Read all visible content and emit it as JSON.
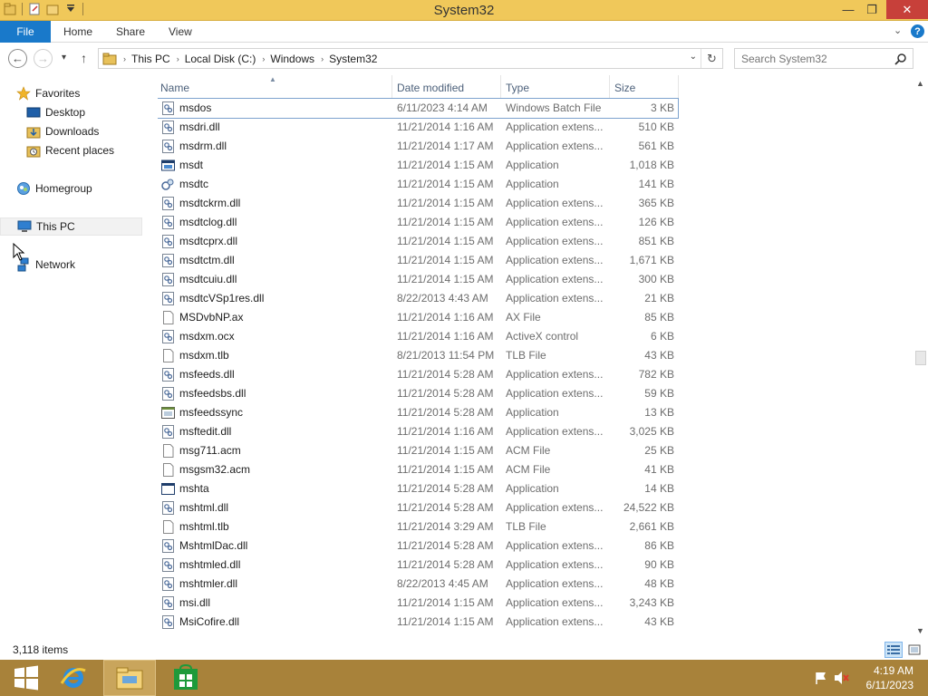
{
  "window": {
    "title": "System32",
    "minimize_glyph": "—",
    "restore_glyph": "❐",
    "close_glyph": "✕"
  },
  "ribbon": {
    "tabs": [
      "File",
      "Home",
      "Share",
      "View"
    ],
    "expand_glyph": "⌄",
    "help_glyph": "?"
  },
  "address": {
    "crumbs": [
      "This PC",
      "Local Disk (C:)",
      "Windows",
      "System32"
    ],
    "separator": "›",
    "dropdown_glyph": "⌄",
    "refresh_glyph": "↻",
    "back_glyph": "←",
    "forward_glyph": "→",
    "recent_glyph": "▾",
    "up_glyph": "↑"
  },
  "search": {
    "placeholder": "Search System32"
  },
  "nav": {
    "favorites": "Favorites",
    "desktop": "Desktop",
    "downloads": "Downloads",
    "recent": "Recent places",
    "homegroup": "Homegroup",
    "thispc": "This PC",
    "network": "Network"
  },
  "columns": {
    "name": "Name",
    "date": "Date modified",
    "type": "Type",
    "size": "Size",
    "sort_glyph": "▲"
  },
  "files": [
    {
      "name": "msdos",
      "date": "6/11/2023 4:14 AM",
      "type": "Windows Batch File",
      "size": "3 KB",
      "icon": "batch-file-icon"
    },
    {
      "name": "msdri.dll",
      "date": "11/21/2014 1:16 AM",
      "type": "Application extens...",
      "size": "510 KB",
      "icon": "dll-icon"
    },
    {
      "name": "msdrm.dll",
      "date": "11/21/2014 1:17 AM",
      "type": "Application extens...",
      "size": "561 KB",
      "icon": "dll-icon"
    },
    {
      "name": "msdt",
      "date": "11/21/2014 1:15 AM",
      "type": "Application",
      "size": "1,018 KB",
      "icon": "app-icon"
    },
    {
      "name": "msdtc",
      "date": "11/21/2014 1:15 AM",
      "type": "Application",
      "size": "141 KB",
      "icon": "dtc-app-icon"
    },
    {
      "name": "msdtckrm.dll",
      "date": "11/21/2014 1:15 AM",
      "type": "Application extens...",
      "size": "365 KB",
      "icon": "dll-icon"
    },
    {
      "name": "msdtclog.dll",
      "date": "11/21/2014 1:15 AM",
      "type": "Application extens...",
      "size": "126 KB",
      "icon": "dll-icon"
    },
    {
      "name": "msdtcprx.dll",
      "date": "11/21/2014 1:15 AM",
      "type": "Application extens...",
      "size": "851 KB",
      "icon": "dll-icon"
    },
    {
      "name": "msdtctm.dll",
      "date": "11/21/2014 1:15 AM",
      "type": "Application extens...",
      "size": "1,671 KB",
      "icon": "dll-icon"
    },
    {
      "name": "msdtcuiu.dll",
      "date": "11/21/2014 1:15 AM",
      "type": "Application extens...",
      "size": "300 KB",
      "icon": "dll-icon"
    },
    {
      "name": "msdtcVSp1res.dll",
      "date": "8/22/2013 4:43 AM",
      "type": "Application extens...",
      "size": "21 KB",
      "icon": "dll-icon"
    },
    {
      "name": "MSDvbNP.ax",
      "date": "11/21/2014 1:16 AM",
      "type": "AX File",
      "size": "85 KB",
      "icon": "blank-file-icon"
    },
    {
      "name": "msdxm.ocx",
      "date": "11/21/2014 1:16 AM",
      "type": "ActiveX control",
      "size": "6 KB",
      "icon": "dll-icon"
    },
    {
      "name": "msdxm.tlb",
      "date": "8/21/2013 11:54 PM",
      "type": "TLB File",
      "size": "43 KB",
      "icon": "blank-file-icon"
    },
    {
      "name": "msfeeds.dll",
      "date": "11/21/2014 5:28 AM",
      "type": "Application extens...",
      "size": "782 KB",
      "icon": "dll-icon"
    },
    {
      "name": "msfeedsbs.dll",
      "date": "11/21/2014 5:28 AM",
      "type": "Application extens...",
      "size": "59 KB",
      "icon": "dll-icon"
    },
    {
      "name": "msfeedssync",
      "date": "11/21/2014 5:28 AM",
      "type": "Application",
      "size": "13 KB",
      "icon": "app-small-icon"
    },
    {
      "name": "msftedit.dll",
      "date": "11/21/2014 1:16 AM",
      "type": "Application extens...",
      "size": "3,025 KB",
      "icon": "dll-icon"
    },
    {
      "name": "msg711.acm",
      "date": "11/21/2014 1:15 AM",
      "type": "ACM File",
      "size": "25 KB",
      "icon": "blank-file-icon"
    },
    {
      "name": "msgsm32.acm",
      "date": "11/21/2014 1:15 AM",
      "type": "ACM File",
      "size": "41 KB",
      "icon": "blank-file-icon"
    },
    {
      "name": "mshta",
      "date": "11/21/2014 5:28 AM",
      "type": "Application",
      "size": "14 KB",
      "icon": "window-app-icon"
    },
    {
      "name": "mshtml.dll",
      "date": "11/21/2014 5:28 AM",
      "type": "Application extens...",
      "size": "24,522 KB",
      "icon": "dll-icon"
    },
    {
      "name": "mshtml.tlb",
      "date": "11/21/2014 3:29 AM",
      "type": "TLB File",
      "size": "2,661 KB",
      "icon": "blank-file-icon"
    },
    {
      "name": "MshtmlDac.dll",
      "date": "11/21/2014 5:28 AM",
      "type": "Application extens...",
      "size": "86 KB",
      "icon": "dll-icon"
    },
    {
      "name": "mshtmled.dll",
      "date": "11/21/2014 5:28 AM",
      "type": "Application extens...",
      "size": "90 KB",
      "icon": "dll-icon"
    },
    {
      "name": "mshtmler.dll",
      "date": "8/22/2013 4:45 AM",
      "type": "Application extens...",
      "size": "48 KB",
      "icon": "dll-icon"
    },
    {
      "name": "msi.dll",
      "date": "11/21/2014 1:15 AM",
      "type": "Application extens...",
      "size": "3,243 KB",
      "icon": "dll-icon"
    },
    {
      "name": "MsiCofire.dll",
      "date": "11/21/2014 1:15 AM",
      "type": "Application extens...",
      "size": "43 KB",
      "icon": "dll-icon"
    }
  ],
  "status": {
    "item_count": "3,118 items"
  },
  "taskbar": {
    "time": "4:19 AM",
    "date": "6/11/2023",
    "accent": "#a8823a"
  },
  "colors": {
    "titlebar": "#f0c85a",
    "file_tab": "#1979ca",
    "close_button": "#c7403a",
    "selection_outline": "#7da2ce"
  }
}
